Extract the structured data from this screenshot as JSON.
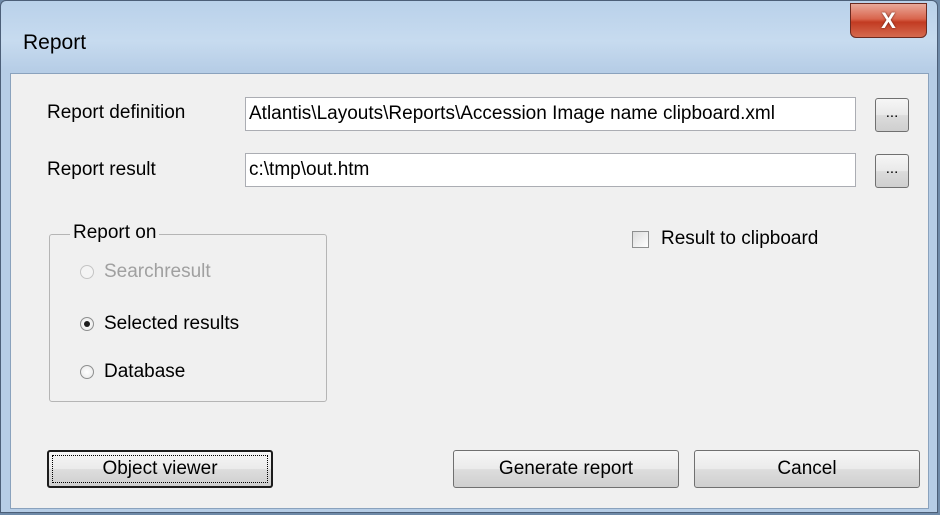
{
  "window": {
    "title": "Report",
    "close_glyph": "X"
  },
  "form": {
    "report_definition_label": "Report definition",
    "report_definition_value": "Atlantis\\Layouts\\Reports\\Accession Image name clipboard.xml",
    "report_result_label": "Report result",
    "report_result_value": "c:\\tmp\\out.htm",
    "browse_label": "..."
  },
  "report_on": {
    "legend": "Report on",
    "options": [
      {
        "label": "Searchresult",
        "selected": false,
        "enabled": false
      },
      {
        "label": "Selected results",
        "selected": true,
        "enabled": true
      },
      {
        "label": "Database",
        "selected": false,
        "enabled": true
      }
    ]
  },
  "result_to_clipboard": {
    "label": "Result to clipboard",
    "checked": false
  },
  "buttons": {
    "object_viewer": "Object viewer",
    "generate_report": "Generate report",
    "cancel": "Cancel"
  }
}
